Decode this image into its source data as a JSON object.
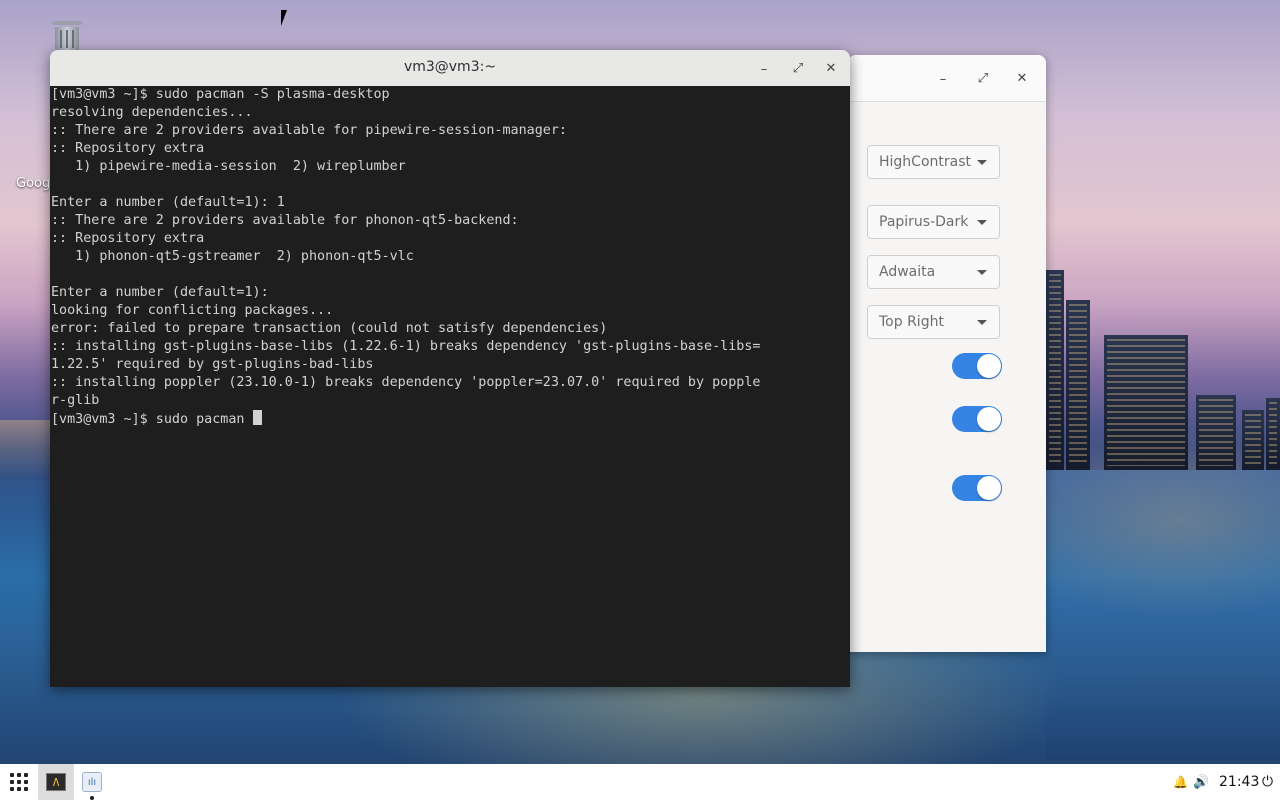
{
  "desktop": {
    "google_label": "Goog"
  },
  "terminal": {
    "title": "vm3@vm3:~",
    "lines": [
      "[vm3@vm3 ~]$ sudo pacman -S plasma-desktop",
      "resolving dependencies...",
      ":: There are 2 providers available for pipewire-session-manager:",
      ":: Repository extra",
      "   1) pipewire-media-session  2) wireplumber",
      "",
      "Enter a number (default=1): 1",
      ":: There are 2 providers available for phonon-qt5-backend:",
      ":: Repository extra",
      "   1) phonon-qt5-gstreamer  2) phonon-qt5-vlc",
      "",
      "Enter a number (default=1):",
      "looking for conflicting packages...",
      "error: failed to prepare transaction (could not satisfy dependencies)",
      ":: installing gst-plugins-base-libs (1.22.6-1) breaks dependency 'gst-plugins-base-libs=",
      "1.22.5' required by gst-plugins-bad-libs",
      ":: installing poppler (23.10.0-1) breaks dependency 'poppler=23.07.0' required by popple",
      "r-glib"
    ],
    "prompt": "[vm3@vm3 ~]$ sudo pacman "
  },
  "settings": {
    "dropdowns": [
      "HighContrast",
      "Papirus-Dark",
      "Adwaita",
      "Top Right"
    ],
    "toggles": [
      true,
      true,
      true
    ]
  },
  "taskbar": {
    "clock": "21:43",
    "term_glyph": "Λ",
    "tweak_glyph": "ılı"
  },
  "icons": {
    "minimize": "–",
    "maximize": "⤢",
    "close": "✕",
    "bell": "🔔",
    "volume": "🔊",
    "power": "⏻"
  }
}
